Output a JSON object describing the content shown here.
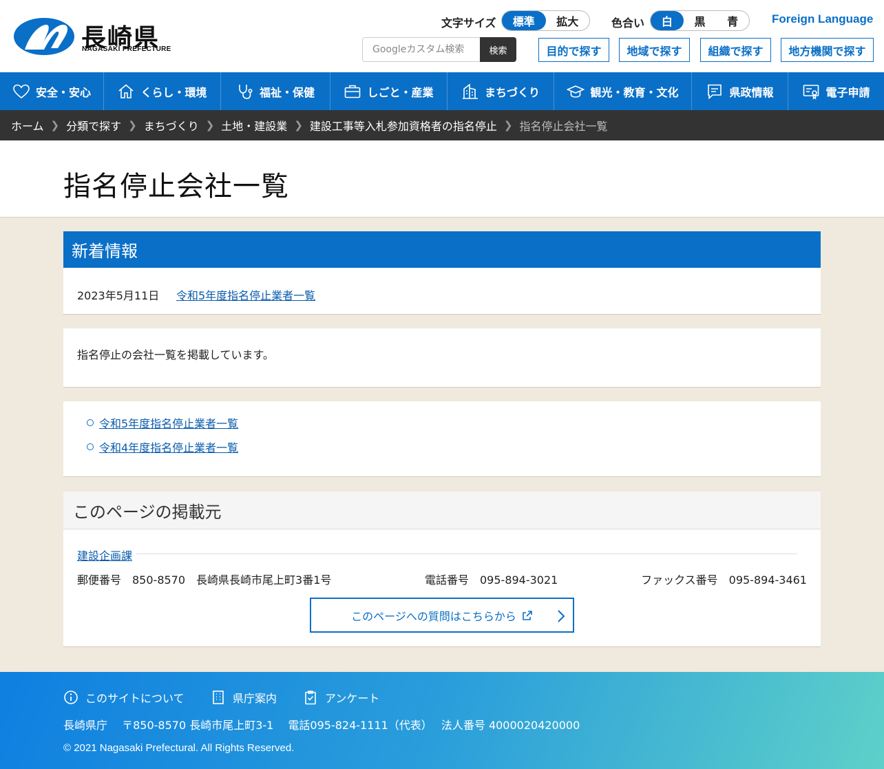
{
  "header": {
    "logo_jp": "長崎県",
    "logo_en": "NAGASAKI PREFECTURE",
    "font_size_label": "文字サイズ",
    "font_size_options": [
      "標準",
      "拡大"
    ],
    "color_label": "色合い",
    "color_options": [
      "白",
      "黒",
      "青"
    ],
    "foreign_language": "Foreign Language",
    "search_placeholder": "Googleカスタム検索",
    "search_button": "検索",
    "find_buttons": [
      "目的で探す",
      "地域で探す",
      "組織で探す",
      "地方機関で探す"
    ]
  },
  "nav": [
    {
      "label": "安全・安心",
      "icon": "heart-icon"
    },
    {
      "label": "くらし・環境",
      "icon": "home-icon"
    },
    {
      "label": "福祉・保健",
      "icon": "stethoscope-icon"
    },
    {
      "label": "しごと・産業",
      "icon": "briefcase-icon"
    },
    {
      "label": "まちづくり",
      "icon": "building-icon"
    },
    {
      "label": "観光・教育・文化",
      "icon": "graduation-cap-icon"
    },
    {
      "label": "県政情報",
      "icon": "speech-bubble-icon"
    },
    {
      "label": "電子申請",
      "icon": "certificate-icon"
    }
  ],
  "breadcrumb": [
    "ホーム",
    "分類で探す",
    "まちづくり",
    "土地・建設業",
    "建設工事等入札参加資格者の指名停止",
    "指名停止会社一覧"
  ],
  "page_title": "指名停止会社一覧",
  "news": {
    "heading": "新着情報",
    "date": "2023年5月11日",
    "link": "令和5年度指名停止業者一覧"
  },
  "intro": "指名停止の会社一覧を掲載しています。",
  "links": [
    "令和5年度指名停止業者一覧",
    "令和4年度指名停止業者一覧"
  ],
  "contact": {
    "heading": "このページの掲載元",
    "department": "建設企画課",
    "postal": "郵便番号　850-8570　長崎県長崎市尾上町3番1号",
    "tel": "電話番号　095-894-3021",
    "fax": "ファックス番号　095-894-3461",
    "inquiry_button": "このページへの質問はこちらから"
  },
  "footer": {
    "links": [
      "このサイトについて",
      "県庁案内",
      "アンケート"
    ],
    "org": "長崎県庁　 〒850-8570 長崎市尾上町3-1　 電話095-824-1111（代表）　 法人番号 4000020420000",
    "copyright": "© 2021 Nagasaki Prefectural. All Rights Reserved."
  },
  "colors": {
    "primary": "#0a6fc7",
    "breadcrumb_bg": "#333333",
    "page_bg": "#f0e9de"
  }
}
